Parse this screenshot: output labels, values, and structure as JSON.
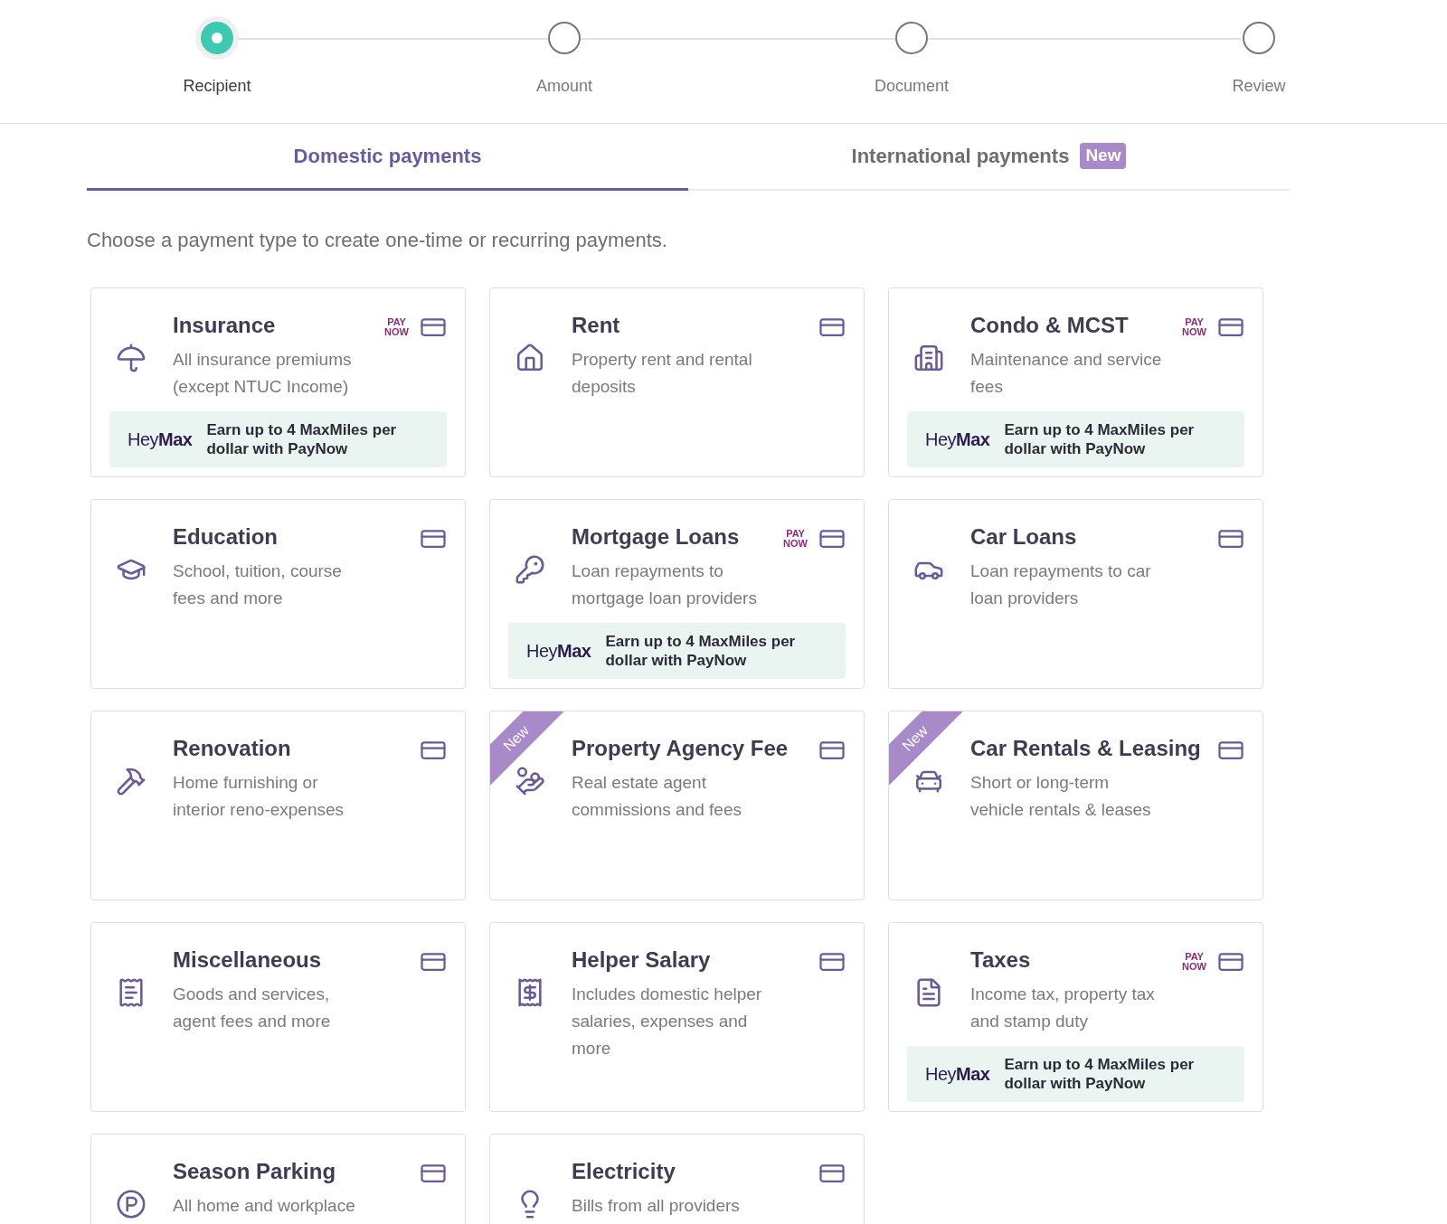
{
  "steps": [
    {
      "label": "Recipient",
      "selected": true
    },
    {
      "label": "Amount",
      "selected": false
    },
    {
      "label": "Document",
      "selected": false
    },
    {
      "label": "Review",
      "selected": false
    }
  ],
  "tabs": [
    {
      "label": "Domestic payments",
      "selected": true
    },
    {
      "label": "International payments",
      "selected": false,
      "badge": "New"
    }
  ],
  "intro": "Choose a payment type to create one-time or recurring payments.",
  "cards": [
    {
      "title": "Insurance",
      "description_lines": [
        "All insurance premiums",
        "(except NTUC Income)"
      ],
      "paynow_logo": {
        "top": "PAY",
        "bottom": "NOW"
      },
      "promo": {
        "brand_light": "Hey",
        "brand_bold": "Max",
        "text": "Earn up to 4 MaxMiles per dollar with PayNow"
      }
    },
    {
      "title": "Rent",
      "description_lines": [
        "Property rent and rental",
        "deposits"
      ]
    },
    {
      "title": "Condo & MCST",
      "description_lines": [
        "Maintenance and service",
        "fees"
      ],
      "paynow_logo": {
        "top": "PAY",
        "bottom": "NOW"
      },
      "promo": {
        "brand_light": "Hey",
        "brand_bold": "Max",
        "text": "Earn up to 4 MaxMiles per dollar with PayNow"
      }
    },
    {
      "title": "Education",
      "description_lines": [
        "School, tuition, course",
        "fees and more"
      ]
    },
    {
      "title": "Mortgage Loans",
      "description_lines": [
        "Loan repayments to",
        "mortgage loan providers"
      ],
      "paynow_logo": {
        "top": "PAY",
        "bottom": "NOW"
      },
      "promo": {
        "brand_light": "Hey",
        "brand_bold": "Max",
        "text": "Earn up to 4 MaxMiles per dollar with PayNow"
      }
    },
    {
      "title": "Car Loans",
      "description_lines": [
        "Loan repayments to car",
        "loan providers"
      ]
    },
    {
      "title": "Renovation",
      "description_lines": [
        "Home furnishing or",
        "interior reno-expenses"
      ]
    },
    {
      "title": "Property Agency Fee",
      "description_lines": [
        "Real estate agent",
        "commissions and fees"
      ],
      "ribbon": "New"
    },
    {
      "title": "Car Rentals & Leasing",
      "description_lines": [
        "Short or long-term",
        "vehicle rentals & leases"
      ],
      "ribbon": "New"
    },
    {
      "title": "Miscellaneous",
      "description_lines": [
        "Goods and services,",
        "agent fees and more"
      ]
    },
    {
      "title": "Helper Salary",
      "description_lines": [
        "Includes domestic helper",
        "salaries, expenses and",
        "more"
      ]
    },
    {
      "title": "Taxes",
      "description_lines": [
        "Income tax, property tax",
        "and stamp duty"
      ],
      "paynow_logo": {
        "top": "PAY",
        "bottom": "NOW"
      },
      "promo": {
        "brand_light": "Hey",
        "brand_bold": "Max",
        "text": "Earn up to 4 MaxMiles per dollar with PayNow"
      }
    },
    {
      "title": "Season Parking",
      "description_lines": [
        "All home and workplace"
      ]
    },
    {
      "title": "Electricity",
      "description_lines": [
        "Bills from all providers"
      ]
    }
  ]
}
